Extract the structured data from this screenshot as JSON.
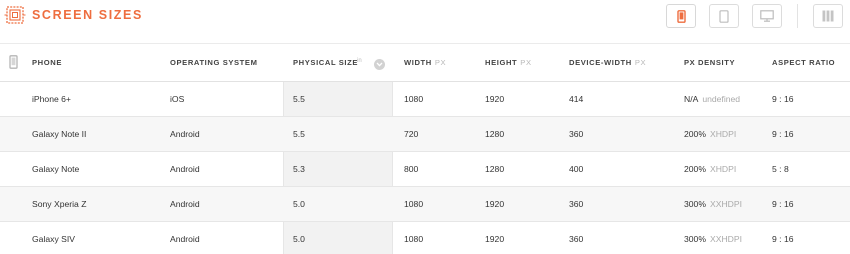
{
  "header": {
    "brand": "SCREEN SIZES",
    "accent": "#ee6d3f",
    "view_buttons": [
      {
        "name": "phone-view",
        "icon": "phone-icon",
        "active": true
      },
      {
        "name": "tablet-view",
        "icon": "tablet-icon",
        "active": false
      },
      {
        "name": "desktop-view",
        "icon": "monitor-icon",
        "active": false
      },
      {
        "name": "columns-view",
        "icon": "columns-icon",
        "active": false
      }
    ]
  },
  "table": {
    "columns": [
      {
        "label": "PHONE",
        "unit": ""
      },
      {
        "label": "OPERATING SYSTEM",
        "unit": ""
      },
      {
        "label": "PHYSICAL SIZE",
        "unit": "in"
      },
      {
        "label": "WIDTH",
        "unit": "PX"
      },
      {
        "label": "HEIGHT",
        "unit": "PX"
      },
      {
        "label": "DEVICE-WIDTH",
        "unit": "PX"
      },
      {
        "label": "PX DENSITY",
        "unit": ""
      },
      {
        "label": "ASPECT RATIO",
        "unit": ""
      }
    ],
    "sorted_column": "PHYSICAL SIZE",
    "rows": [
      {
        "phone": "iPhone 6+",
        "os": "iOS",
        "size": "5.5",
        "width": "1080",
        "height": "1920",
        "device_width": "414",
        "density": "N/A",
        "density_label": "undefined",
        "aspect": "9 : 16"
      },
      {
        "phone": "Galaxy Note II",
        "os": "Android",
        "size": "5.5",
        "width": "720",
        "height": "1280",
        "device_width": "360",
        "density": "200%",
        "density_label": "XHDPI",
        "aspect": "9 : 16"
      },
      {
        "phone": "Galaxy Note",
        "os": "Android",
        "size": "5.3",
        "width": "800",
        "height": "1280",
        "device_width": "400",
        "density": "200%",
        "density_label": "XHDPI",
        "aspect": "5 : 8"
      },
      {
        "phone": "Sony Xperia Z",
        "os": "Android",
        "size": "5.0",
        "width": "1080",
        "height": "1920",
        "device_width": "360",
        "density": "300%",
        "density_label": "XXHDPI",
        "aspect": "9 : 16"
      },
      {
        "phone": "Galaxy SIV",
        "os": "Android",
        "size": "5.0",
        "width": "1080",
        "height": "1920",
        "device_width": "360",
        "density": "300%",
        "density_label": "XXHDPI",
        "aspect": "9 : 16"
      }
    ]
  }
}
